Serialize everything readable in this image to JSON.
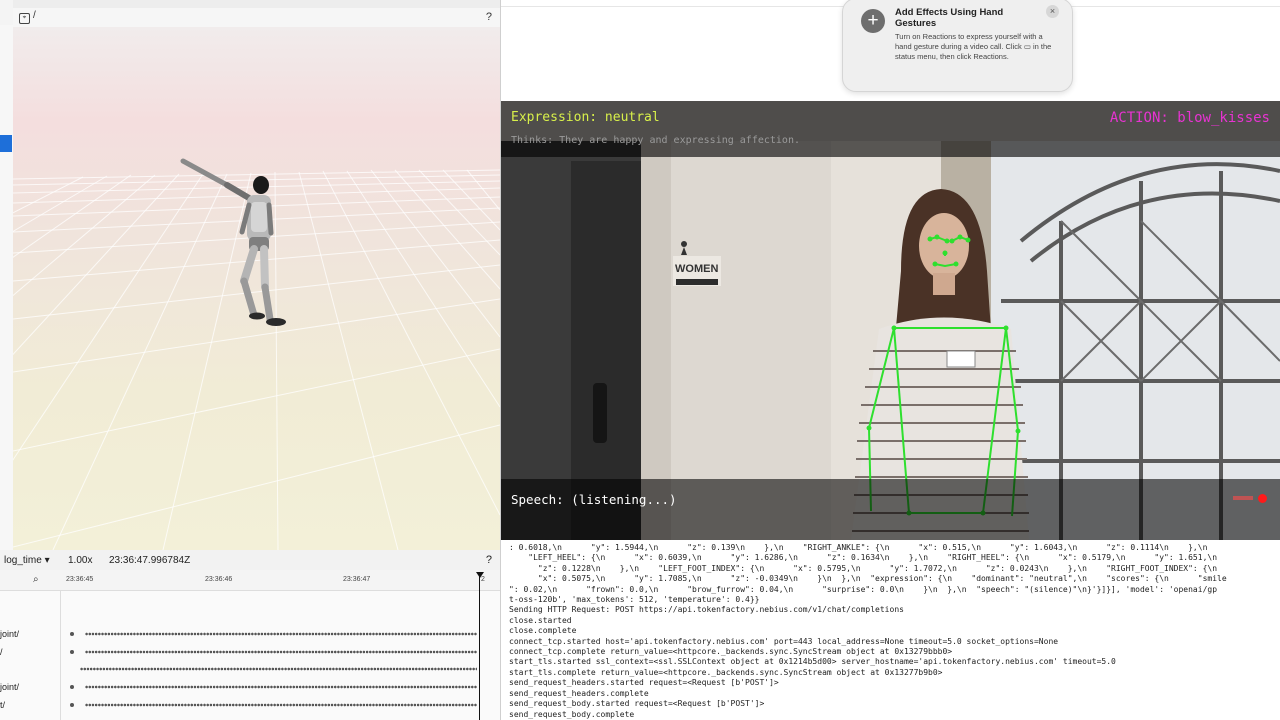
{
  "viewer": {
    "tab_label": "/",
    "help": "?"
  },
  "timeline": {
    "timeline_name": "log_time ▾",
    "speed": "1.00x",
    "current_time": "23:36:47.996784Z",
    "ticks": [
      "23:36:45",
      "23:36:46",
      "23:36:47",
      "2"
    ],
    "help": "?",
    "rows": [
      "joint/",
      "/",
      "",
      "joint/",
      "t/"
    ]
  },
  "notification": {
    "title": "Add Effects Using Hand Gestures",
    "body": "Turn on Reactions to express yourself with a hand gesture during a video call. Click ▭ in the status menu, then click Reactions.",
    "close_glyph": "×",
    "plus_glyph": "+"
  },
  "video": {
    "expression": "Expression: neutral",
    "action": "ACTION: blow_kisses",
    "thinks": "Thinks: They are happy and expressing affection.",
    "speech": "Speech: (listening...)",
    "sign_text": "WOMEN"
  },
  "terminal": {
    "lines": [
      ": 0.6018,\\n      \"y\": 1.5944,\\n      \"z\": 0.139\\n    },\\n    \"RIGHT_ANKLE\": {\\n      \"x\": 0.515,\\n      \"y\": 1.6043,\\n      \"z\": 0.1114\\n    },\\n",
      "    \"LEFT_HEEL\": {\\n      \"x\": 0.6039,\\n      \"y\": 1.6286,\\n      \"z\": 0.1634\\n    },\\n    \"RIGHT_HEEL\": {\\n      \"x\": 0.5179,\\n      \"y\": 1.651,\\n",
      "      \"z\": 0.1228\\n    },\\n    \"LEFT_FOOT_INDEX\": {\\n      \"x\": 0.5795,\\n      \"y\": 1.7072,\\n      \"z\": 0.0243\\n    },\\n    \"RIGHT_FOOT_INDEX\": {\\n",
      "      \"x\": 0.5075,\\n      \"y\": 1.7085,\\n      \"z\": -0.0349\\n    }\\n  },\\n  \"expression\": {\\n    \"dominant\": \"neutral\",\\n    \"scores\": {\\n      \"smile",
      "\": 0.02,\\n      \"frown\": 0.0,\\n      \"brow_furrow\": 0.04,\\n      \"surprise\": 0.0\\n    }\\n  },\\n  \"speech\": \"(silence)\"\\n}'}]}], 'model': 'openai/gp",
      "t-oss-120b', 'max_tokens': 512, 'temperature': 0.4}}",
      "Sending HTTP Request: POST https://api.tokenfactory.nebius.com/v1/chat/completions",
      "close.started",
      "close.complete",
      "connect_tcp.started host='api.tokenfactory.nebius.com' port=443 local_address=None timeout=5.0 socket_options=None",
      "connect_tcp.complete return_value=<httpcore._backends.sync.SyncStream object at 0x13279bbb0>",
      "start_tls.started ssl_context=<ssl.SSLContext object at 0x1214b5d00> server_hostname='api.tokenfactory.nebius.com' timeout=5.0",
      "start_tls.complete return_value=<httpcore._backends.sync.SyncStream object at 0x13277b9b0>",
      "send_request_headers.started request=<Request [b'POST']>",
      "send_request_headers.complete",
      "send_request_body.started request=<Request [b'POST']>",
      "send_request_body.complete"
    ]
  }
}
